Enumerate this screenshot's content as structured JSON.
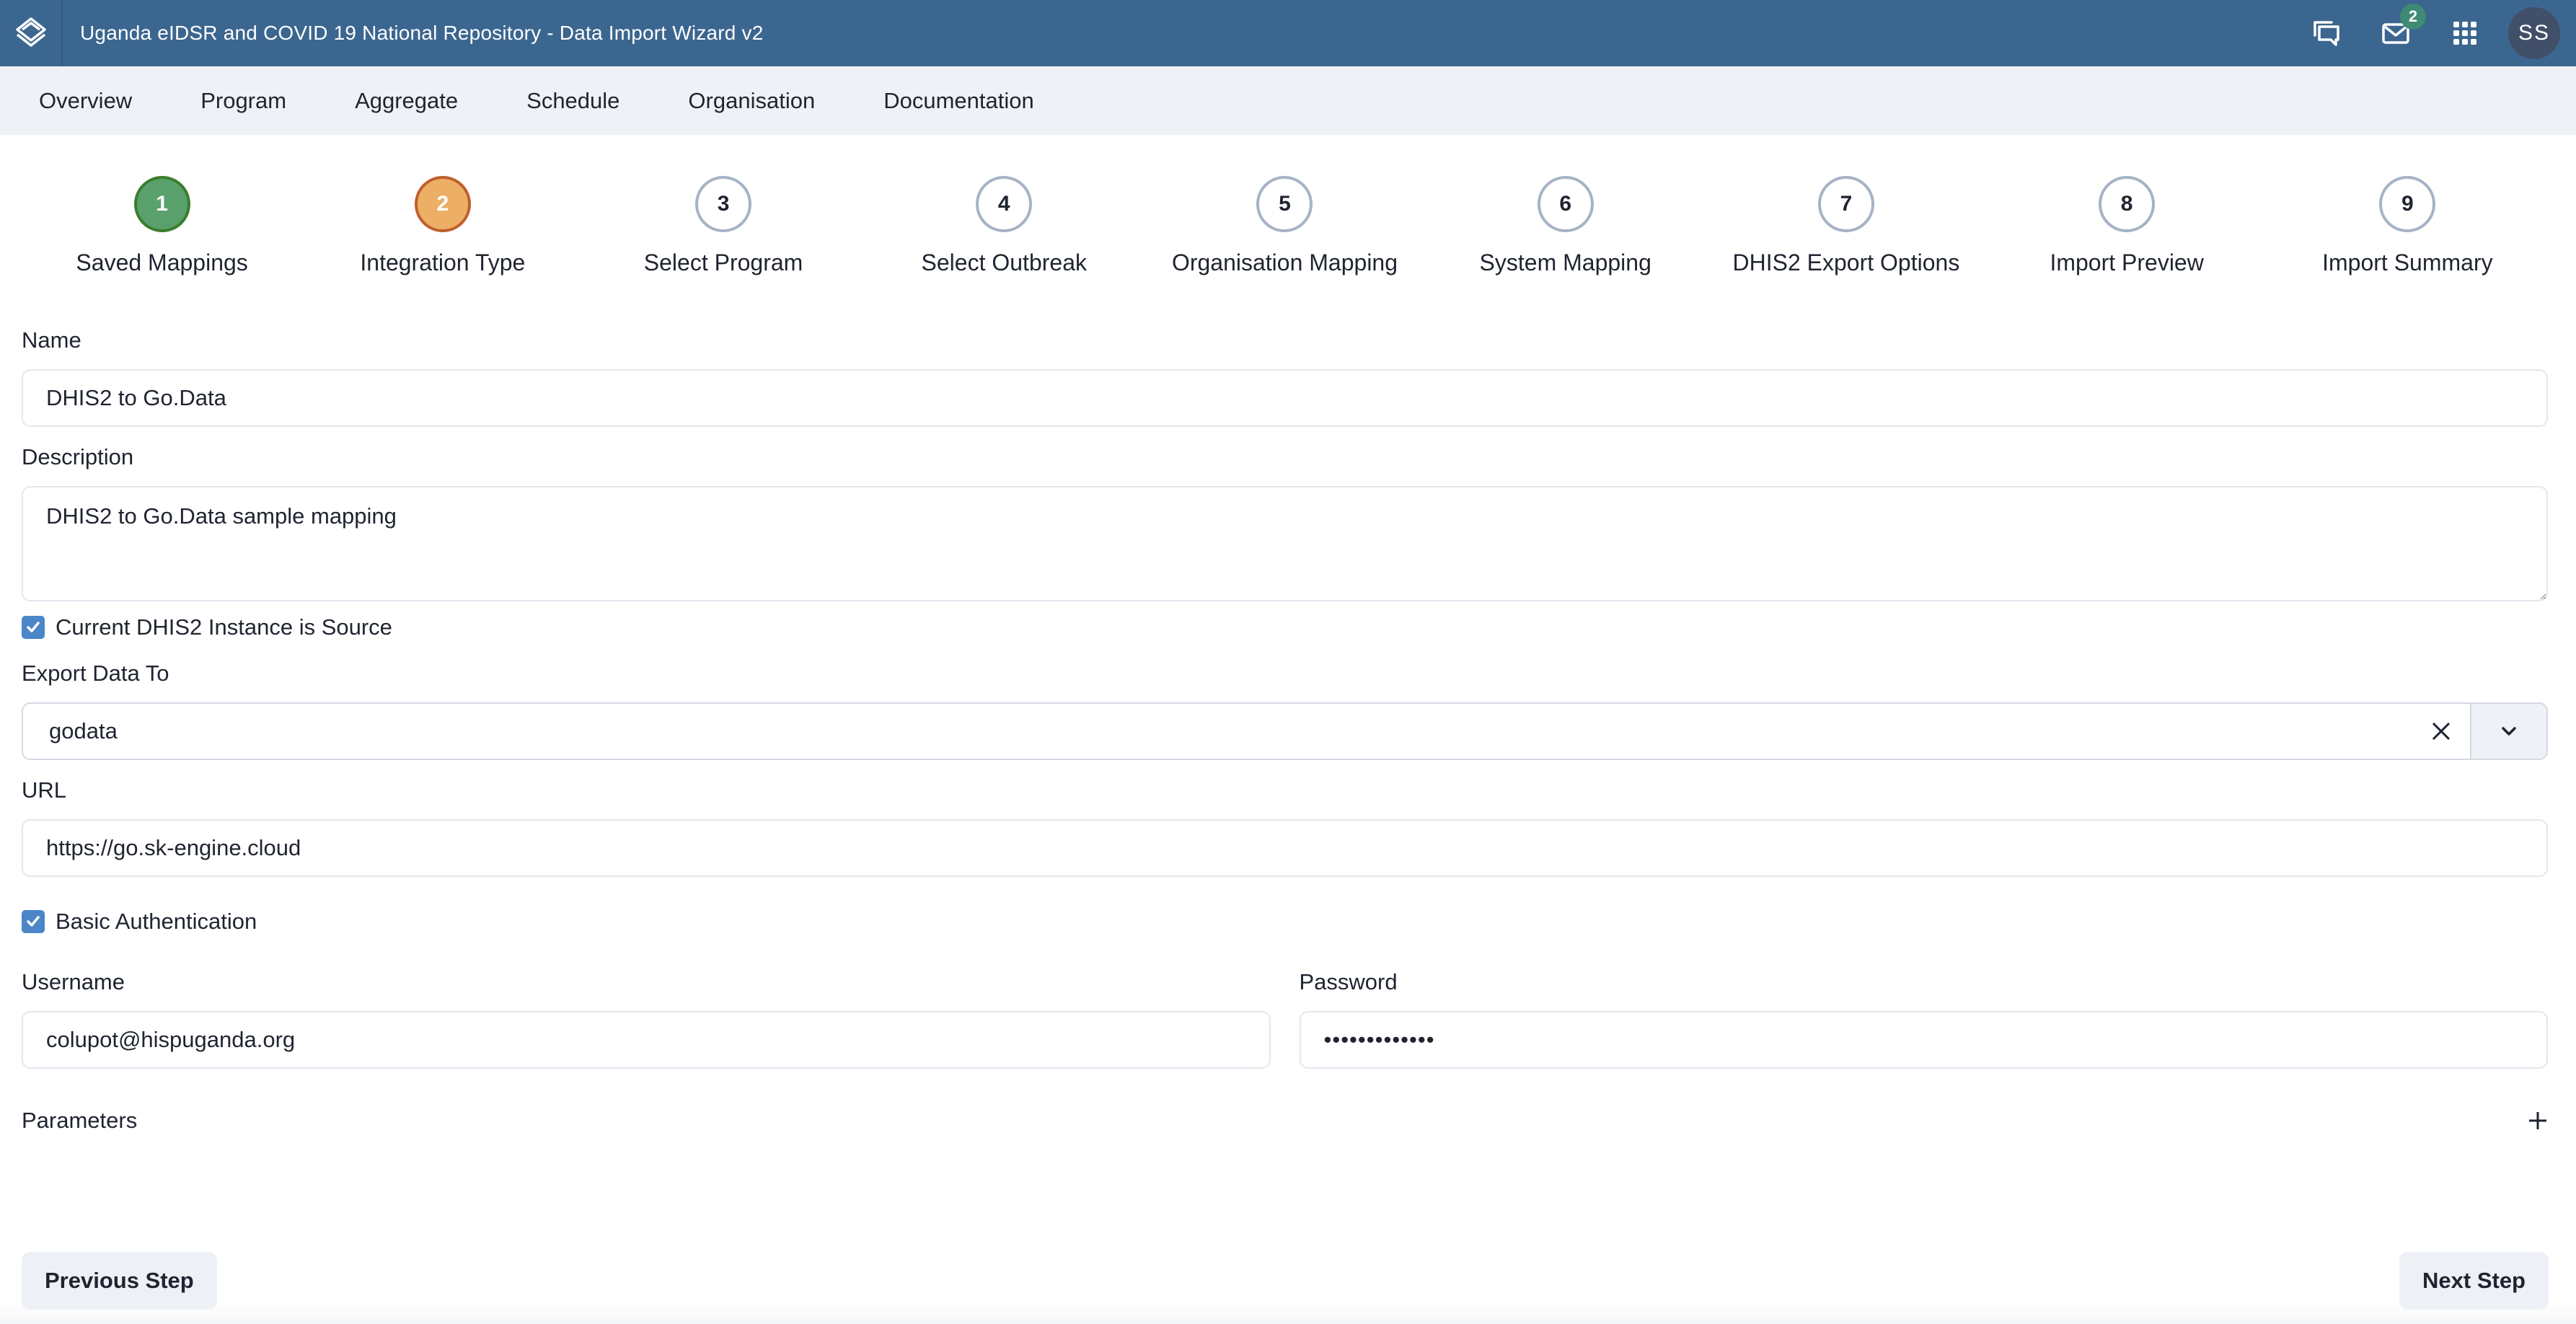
{
  "header": {
    "title": "Uganda eIDSR and COVID 19 National Repository - Data Import Wizard v2",
    "icons": [
      "logo-icon",
      "messages-icon",
      "mail-icon",
      "apps-icon"
    ],
    "mail_badge": "2",
    "avatar_initials": "SS",
    "color": "#3b668f"
  },
  "nav": {
    "items": [
      {
        "label": "Overview"
      },
      {
        "label": "Program"
      },
      {
        "label": "Aggregate"
      },
      {
        "label": "Schedule"
      },
      {
        "label": "Organisation"
      },
      {
        "label": "Documentation"
      }
    ]
  },
  "stepper": {
    "steps": [
      {
        "number": "1",
        "label": "Saved Mappings",
        "state": "done"
      },
      {
        "number": "2",
        "label": "Integration Type",
        "state": "active"
      },
      {
        "number": "3",
        "label": "Select Program",
        "state": "pending"
      },
      {
        "number": "4",
        "label": "Select Outbreak",
        "state": "pending"
      },
      {
        "number": "5",
        "label": "Organisation Mapping",
        "state": "pending"
      },
      {
        "number": "6",
        "label": "System Mapping",
        "state": "pending"
      },
      {
        "number": "7",
        "label": "DHIS2 Export Options",
        "state": "pending"
      },
      {
        "number": "8",
        "label": "Import Preview",
        "state": "pending"
      },
      {
        "number": "9",
        "label": "Import Summary",
        "state": "pending"
      }
    ],
    "colors": {
      "done": "#59a06d",
      "active": "#ecaf65",
      "pending": "#a6b3c6"
    }
  },
  "form": {
    "name": {
      "label": "Name",
      "value": "DHIS2 to Go.Data"
    },
    "description": {
      "label": "Description",
      "value": "DHIS2 to Go.Data sample mapping"
    },
    "current_instance_source": {
      "label": "Current DHIS2 Instance is Source",
      "checked": true
    },
    "export_to": {
      "label": "Export Data To",
      "value": "godata"
    },
    "url": {
      "label": "URL",
      "value": "https://go.sk-engine.cloud"
    },
    "basic_auth": {
      "label": "Basic Authentication",
      "checked": true
    },
    "username": {
      "label": "Username",
      "value": "colupot@hispuganda.org"
    },
    "password": {
      "label": "Password",
      "value": "•••••••••••••"
    },
    "parameters": {
      "label": "Parameters"
    }
  },
  "footer": {
    "previous_label": "Previous Step",
    "next_label": "Next Step"
  }
}
